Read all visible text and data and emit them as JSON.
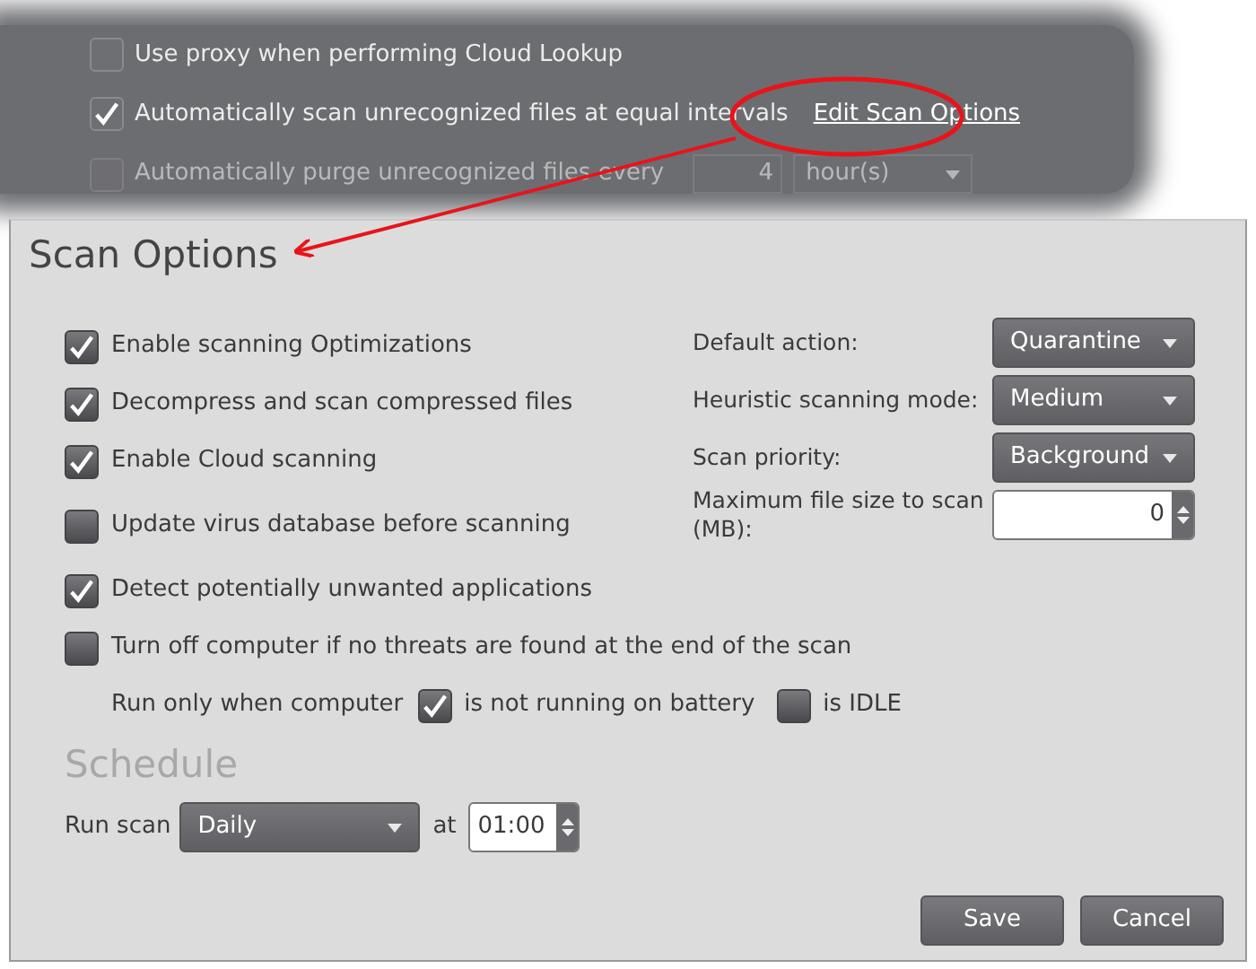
{
  "background_panel": {
    "options": [
      {
        "label": "Use proxy when performing Cloud Lookup",
        "checked": false
      },
      {
        "label": "Automatically scan unrecognized files at equal intervals",
        "checked": true,
        "link": "Edit Scan Options"
      }
    ],
    "purge": {
      "label": "Automatically purge unrecognized files every",
      "checked": false,
      "value": "4",
      "unit": "hour(s)"
    }
  },
  "dialog": {
    "title": "Scan Options",
    "options": [
      {
        "label": "Enable scanning Optimizations",
        "checked": true
      },
      {
        "label": "Decompress and scan compressed files",
        "checked": true
      },
      {
        "label": "Enable Cloud scanning",
        "checked": true
      },
      {
        "label": "Update virus database before scanning",
        "checked": false
      },
      {
        "label": "Detect potentially unwanted applications",
        "checked": true
      },
      {
        "label": "Turn off computer if no threats are found at the end of the scan",
        "checked": false
      }
    ],
    "run_only": {
      "label": "Run only when computer",
      "conditions": [
        {
          "label": "is not running on battery",
          "checked": true
        },
        {
          "label": "is IDLE",
          "checked": false
        }
      ]
    },
    "settings": [
      {
        "kind": "select",
        "label": "Default action:",
        "value": "Quarantine"
      },
      {
        "kind": "select",
        "label": "Heuristic scanning mode:",
        "value": "Medium"
      },
      {
        "kind": "select",
        "label": "Scan priority:",
        "value": "Background"
      },
      {
        "kind": "number",
        "label": "Maximum file size to scan (MB):",
        "value": "0"
      }
    ],
    "schedule": {
      "title": "Schedule",
      "label": "Run scan",
      "frequency": "Daily",
      "at_label": "at",
      "time": "01:00"
    },
    "buttons": [
      "Save",
      "Cancel"
    ]
  }
}
